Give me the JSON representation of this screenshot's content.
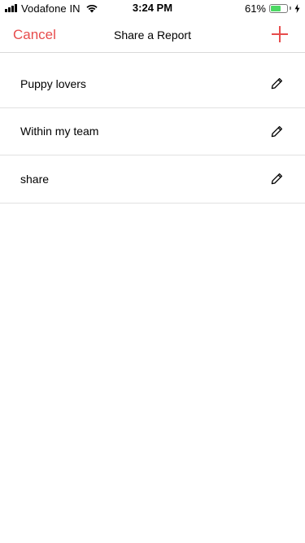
{
  "status_bar": {
    "carrier": "Vodafone IN",
    "time": "3:24 PM",
    "battery_percent": "61%",
    "battery_level": 0.61,
    "battery_color": "#4cd964",
    "signal_icon": "cellular-signal-icon",
    "wifi_icon": "wifi-icon",
    "charging_icon": "charging-bolt-icon"
  },
  "nav": {
    "cancel_label": "Cancel",
    "title": "Share a Report",
    "add_icon": "plus-icon",
    "accent_color": "#e74c4c"
  },
  "list": {
    "items": [
      {
        "label": "Puppy lovers",
        "icon": "pencil-edit-icon"
      },
      {
        "label": "Within my team",
        "icon": "pencil-edit-icon"
      },
      {
        "label": "share",
        "icon": "pencil-edit-icon"
      }
    ]
  }
}
